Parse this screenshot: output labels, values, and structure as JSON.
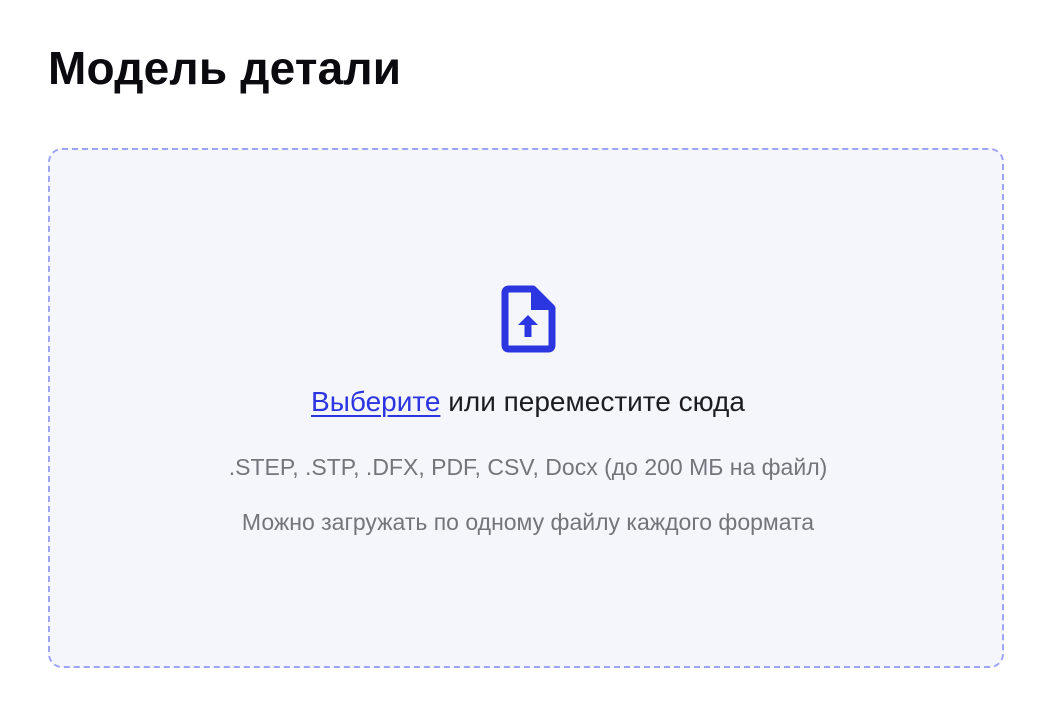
{
  "page": {
    "title": "Модель детали"
  },
  "dropzone": {
    "icon": "file-upload-icon",
    "choose_link": "Выберите",
    "prompt_rest": " или переместите сюда",
    "formats_hint": ".STEP, .STP, .DFX, PDF, CSV, Docx (до 200 МБ на файл)",
    "limit_hint": "Можно загружать по одному файлу каждого формата"
  },
  "colors": {
    "accent": "#2b35e0",
    "dropzone_border": "#9ea3f2",
    "dropzone_background": "#f5f6fc",
    "hint_text": "#74757c"
  }
}
